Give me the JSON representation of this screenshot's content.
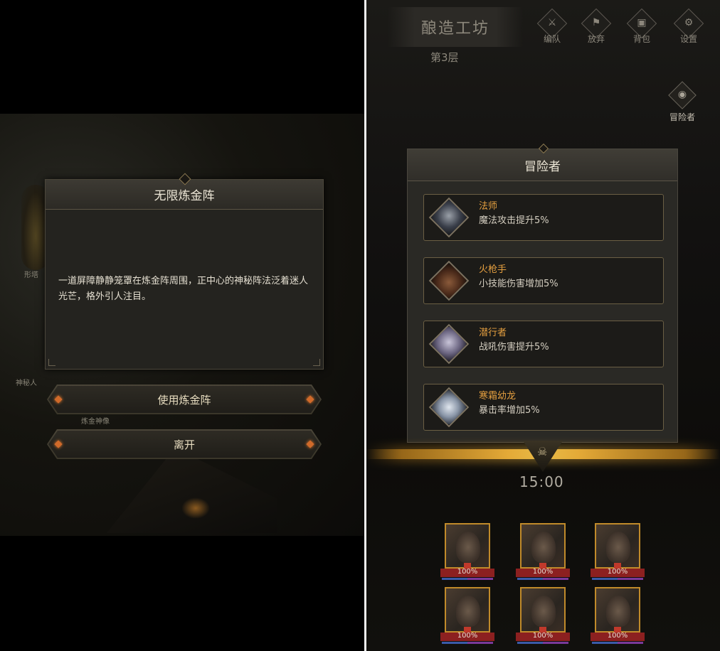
{
  "left_screen": {
    "faint_labels": [
      "形塔",
      "神秘人",
      "炼金神像"
    ],
    "dialog": {
      "title": "无限炼金阵",
      "text": "一道屏障静静笼罩在炼金阵周围，正中心的神秘阵法泛着迷人光芒，格外引人注目。"
    },
    "buttons": {
      "use_label": "使用炼金阵",
      "leave_label": "离开"
    }
  },
  "right_screen": {
    "location_title": "酿造工坊",
    "floor_label": "第3层",
    "top_menu": [
      {
        "label": "编队",
        "icon": "team-icon"
      },
      {
        "label": "放弃",
        "icon": "abandon-icon"
      },
      {
        "label": "背包",
        "icon": "backpack-icon"
      },
      {
        "label": "设置",
        "icon": "settings-icon"
      }
    ],
    "adventurer_button_label": "冒险者",
    "adventurer_panel": {
      "title": "冒险者",
      "cards": [
        {
          "name": "法师",
          "desc": "魔法攻击提升5%",
          "portrait": "mage-portrait"
        },
        {
          "name": "火枪手",
          "desc": "小技能伤害增加5%",
          "portrait": "gunner-portrait"
        },
        {
          "name": "潜行者",
          "desc": "战吼伤害提升5%",
          "portrait": "rogue-portrait"
        },
        {
          "name": "寒霜幼龙",
          "desc": "暴击率增加5%",
          "portrait": "frost-dragon-portrait"
        }
      ]
    },
    "timer": "15:00",
    "heroes": [
      {
        "hp": "100%"
      },
      {
        "hp": "100%"
      },
      {
        "hp": "100%"
      },
      {
        "hp": "100%"
      },
      {
        "hp": "100%"
      },
      {
        "hp": "100%"
      }
    ]
  },
  "colors": {
    "accent_gold": "#e6a040",
    "button_gem": "#d06a2a",
    "hero_frame": "#c08a2a"
  }
}
